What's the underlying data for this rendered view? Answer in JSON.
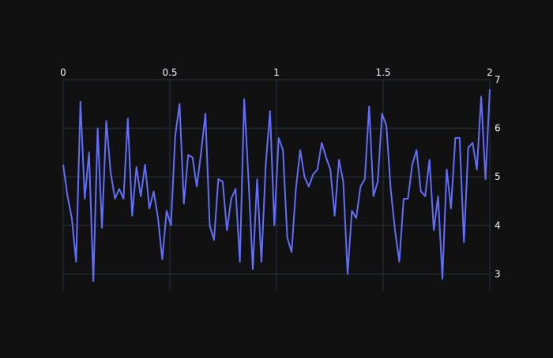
{
  "chart_data": {
    "type": "line",
    "title": "",
    "xlabel": "",
    "ylabel": "",
    "xlim": [
      0,
      2
    ],
    "ylim": [
      2.65,
      7.0
    ],
    "x_ticks": [
      0,
      0.5,
      1,
      1.5,
      2
    ],
    "x_tick_labels": [
      "0",
      "0.5",
      "1",
      "1.5",
      "2"
    ],
    "x_axis_side": "top",
    "y_ticks": [
      3,
      4,
      5,
      6,
      7
    ],
    "y_tick_labels": [
      "3",
      "4",
      "5",
      "6",
      "7"
    ],
    "y_axis_side": "right",
    "grid": true,
    "legend": "none",
    "colors": {
      "background": "#111111",
      "grid": "#283442",
      "tick_text": "#f2f5fa",
      "line": "#636efa"
    },
    "series": [
      {
        "x": [
          0.0,
          0.0202,
          0.0404,
          0.0606,
          0.0808,
          0.101,
          0.1212,
          0.1414,
          0.1616,
          0.1818,
          0.202,
          0.2222,
          0.2424,
          0.2626,
          0.2828,
          0.303,
          0.3232,
          0.3434,
          0.3636,
          0.3838,
          0.404,
          0.4242,
          0.4444,
          0.4646,
          0.4848,
          0.5051,
          0.5253,
          0.5455,
          0.5657,
          0.5859,
          0.6061,
          0.6263,
          0.6465,
          0.6667,
          0.6869,
          0.7071,
          0.7273,
          0.7475,
          0.7677,
          0.7879,
          0.8081,
          0.8283,
          0.8485,
          0.8687,
          0.8889,
          0.9091,
          0.9293,
          0.9495,
          0.9697,
          0.9899,
          1.0101,
          1.0303,
          1.0505,
          1.0707,
          1.0909,
          1.1111,
          1.1313,
          1.1515,
          1.1717,
          1.1919,
          1.2121,
          1.2323,
          1.2525,
          1.2727,
          1.2929,
          1.3131,
          1.3333,
          1.3535,
          1.3737,
          1.3939,
          1.4141,
          1.4343,
          1.4545,
          1.4747,
          1.4949,
          1.5152,
          1.5354,
          1.5556,
          1.5758,
          1.596,
          1.6162,
          1.6364,
          1.6566,
          1.6768,
          1.697,
          1.7172,
          1.7374,
          1.7576,
          1.7778,
          1.798,
          1.8182,
          1.8384,
          1.8586,
          1.8788,
          1.899,
          1.9192,
          1.9394,
          1.9596,
          1.9798,
          2.0
        ],
        "values": [
          5.25,
          4.6,
          4.15,
          3.25,
          6.55,
          4.55,
          5.5,
          2.85,
          6.0,
          3.95,
          6.15,
          5.1,
          4.55,
          4.75,
          4.55,
          6.2,
          4.2,
          5.2,
          4.6,
          5.25,
          4.35,
          4.7,
          4.15,
          3.3,
          4.3,
          4.0,
          5.85,
          6.5,
          4.45,
          5.45,
          5.4,
          4.8,
          5.5,
          6.3,
          4.0,
          3.7,
          4.95,
          4.9,
          3.9,
          4.55,
          4.75,
          3.25,
          6.6,
          4.95,
          3.1,
          4.95,
          3.25,
          5.25,
          6.35,
          4.0,
          5.8,
          5.55,
          3.75,
          3.45,
          4.75,
          5.55,
          5.0,
          4.8,
          5.05,
          5.15,
          5.7,
          5.4,
          5.15,
          4.2,
          5.35,
          4.9,
          3.0,
          4.3,
          4.15,
          4.8,
          4.95,
          6.45,
          4.6,
          4.9,
          6.3,
          6.05,
          4.75,
          3.9,
          3.25,
          4.55,
          4.55,
          5.25,
          5.55,
          4.7,
          4.6,
          5.35,
          3.9,
          4.6,
          2.9,
          5.15,
          4.35,
          5.8,
          5.8,
          3.65,
          5.6,
          5.7,
          5.15,
          6.65,
          4.95,
          6.8
        ]
      }
    ]
  }
}
